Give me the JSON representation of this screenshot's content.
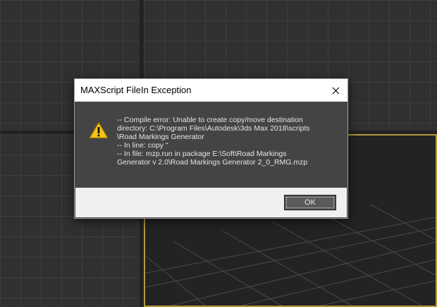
{
  "dialog": {
    "title": "MAXScript FileIn Exception",
    "close_glyph": "✕",
    "message_lines": [
      "-- Compile error: Unable to create copy/move destination",
      "directory:  C:\\Program Files\\Autodesk\\3ds Max 2018\\scripts",
      "\\Road Markings Generator",
      "--  In line: copy \"",
      "--  In file: mzp.run in package E:\\Soft\\Road Markings",
      "Generator v 2.0\\Road Markings Generator 2_0_RMG.mzp"
    ],
    "ok_label": "OK",
    "icon": "warning-icon"
  },
  "colors": {
    "content_bg": "#444444",
    "footer_bg": "#f0f0f0",
    "warning_yellow": "#f5c518",
    "active_viewport_border": "#b59a3c"
  }
}
